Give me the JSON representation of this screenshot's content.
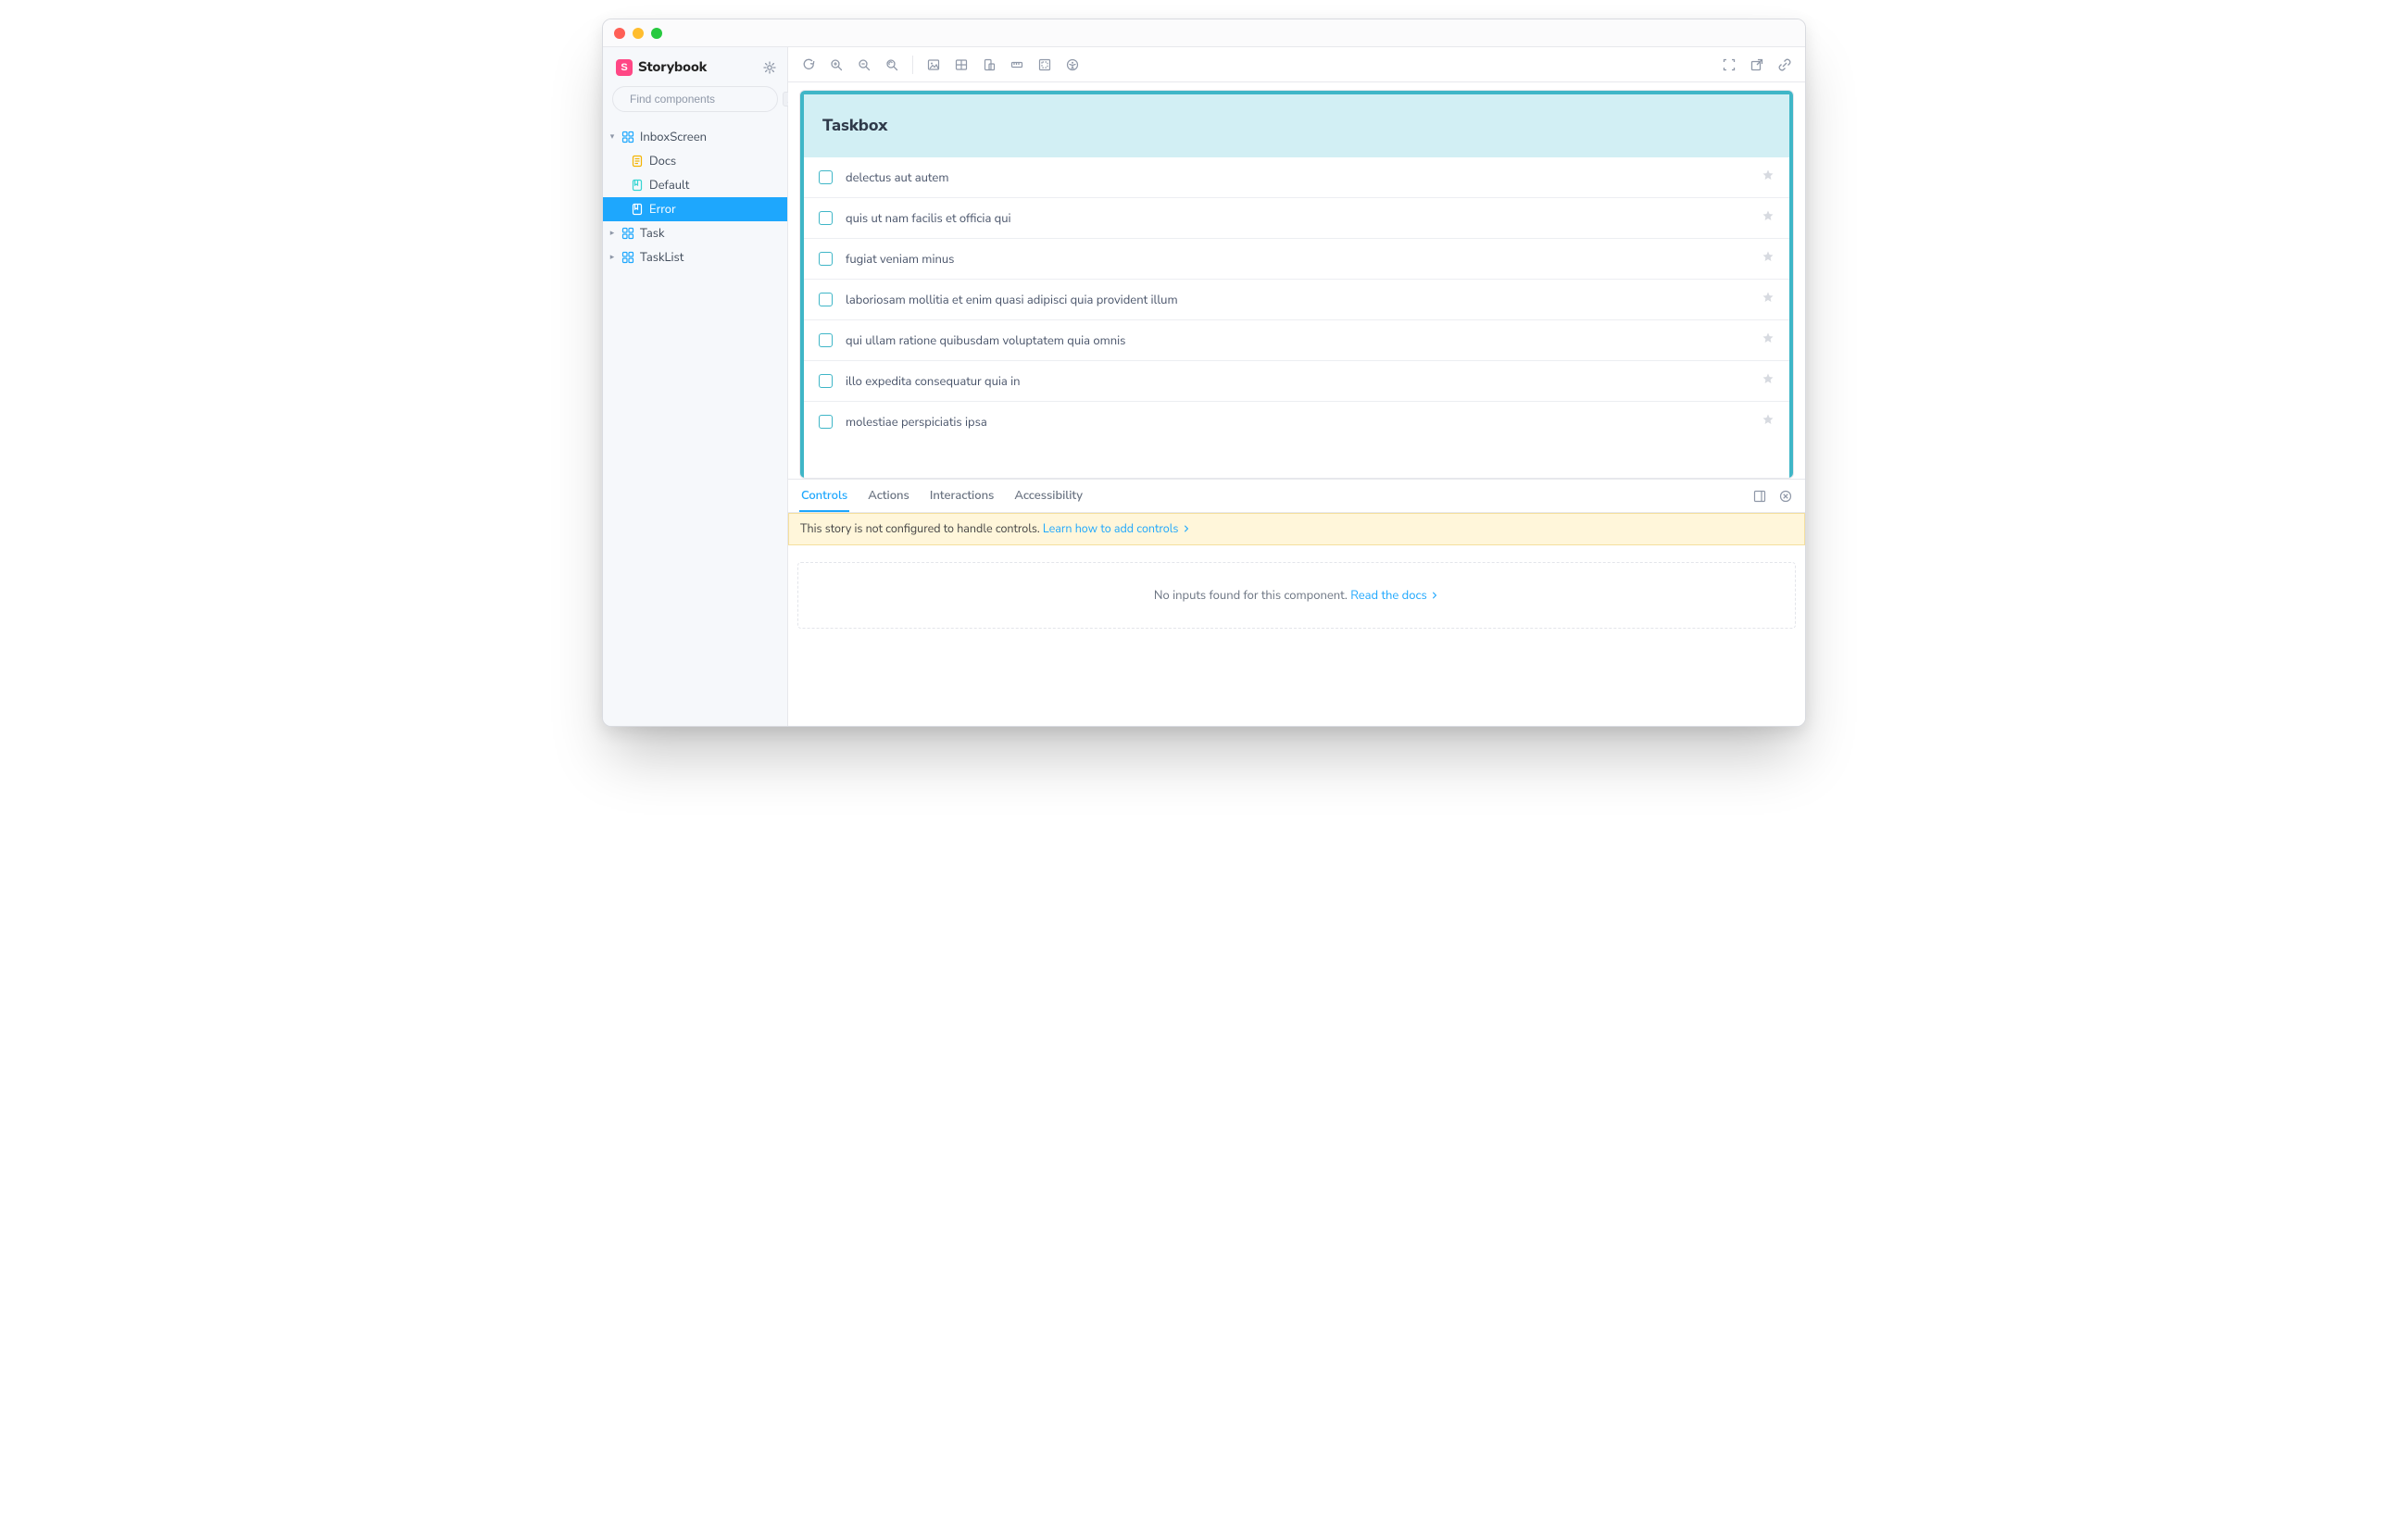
{
  "brand": {
    "name": "Storybook",
    "logo_glyph": "S"
  },
  "sidebar": {
    "search_placeholder": "Find components",
    "search_shortcut": "/",
    "items": [
      {
        "kind": "component",
        "label": "InboxScreen",
        "expanded": true
      },
      {
        "kind": "docs",
        "label": "Docs",
        "depth": 1
      },
      {
        "kind": "story",
        "label": "Default",
        "depth": 1
      },
      {
        "kind": "story",
        "label": "Error",
        "depth": 1,
        "selected": true
      },
      {
        "kind": "component",
        "label": "Task"
      },
      {
        "kind": "component",
        "label": "TaskList"
      }
    ]
  },
  "preview": {
    "heading": "Taskbox",
    "tasks": [
      {
        "title": "delectus aut autem"
      },
      {
        "title": "quis ut nam facilis et officia qui"
      },
      {
        "title": "fugiat veniam minus"
      },
      {
        "title": "laboriosam mollitia et enim quasi adipisci quia provident illum"
      },
      {
        "title": "qui ullam ratione quibusdam voluptatem quia omnis"
      },
      {
        "title": "illo expedita consequatur quia in"
      },
      {
        "title": "molestiae perspiciatis ipsa"
      }
    ]
  },
  "addons": {
    "tabs": {
      "controls": "Controls",
      "actions": "Actions",
      "interactions": "Interactions",
      "accessibility": "Accessibility"
    },
    "active_tab": "controls",
    "banner_text": "This story is not configured to handle controls.",
    "banner_link_label": "Learn how to add controls",
    "empty_text": "No inputs found for this component.",
    "empty_link_label": "Read the docs"
  },
  "colors": {
    "accent": "#1EA7FD",
    "storybook_pink": "#ff4785",
    "taskbox_teal": "#3FB6C7"
  }
}
